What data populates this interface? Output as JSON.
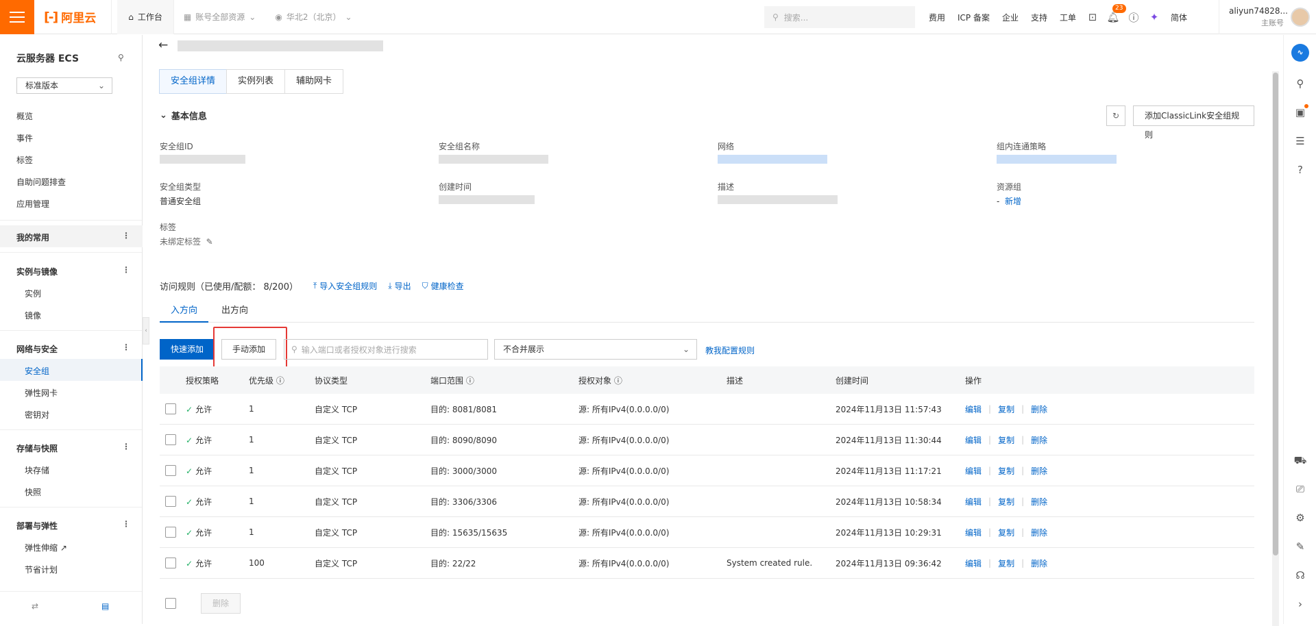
{
  "topbar": {
    "brand": "阿里云",
    "workbench": "工作台",
    "account_scope": "账号全部资源",
    "region": "华北2（北京）",
    "search_placeholder": "搜索...",
    "links": [
      "费用",
      "ICP 备案",
      "企业",
      "支持",
      "工单"
    ],
    "notification_count": "23",
    "language": "简体",
    "username": "aliyun74828...",
    "role": "主账号"
  },
  "sidebar": {
    "title": "云服务器 ECS",
    "version": "标准版本",
    "top_items": [
      "概览",
      "事件",
      "标签",
      "自助问题排查",
      "应用管理"
    ],
    "common": "我的常用",
    "groups": [
      {
        "title": "实例与镜像",
        "items": [
          "实例",
          "镜像"
        ]
      },
      {
        "title": "网络与安全",
        "items": [
          "安全组",
          "弹性网卡",
          "密钥对"
        ]
      },
      {
        "title": "存储与快照",
        "items": [
          "块存储",
          "快照"
        ]
      },
      {
        "title": "部署与弹性",
        "items": [
          "弹性伸缩",
          "节省计划"
        ]
      }
    ]
  },
  "tabs": [
    "安全组详情",
    "实例列表",
    "辅助网卡"
  ],
  "basic_info": {
    "title": "基本信息",
    "classic_button": "添加ClassicLink安全组规则",
    "labels": {
      "sg_id": "安全组ID",
      "sg_name": "安全组名称",
      "network": "网络",
      "intra_policy": "组内连通策略",
      "sg_type": "安全组类型",
      "created": "创建时间",
      "desc": "描述",
      "resource_group": "资源组",
      "tags": "标签"
    },
    "sg_type_value": "普通安全组",
    "resource_group_value": "-",
    "resource_group_add": "新增",
    "tags_value": "未绑定标签"
  },
  "rules": {
    "title": "访问规则（已使用/配额： 8/200）",
    "import": "导入安全组规则",
    "export": "导出",
    "health": "健康检查",
    "direction_in": "入方向",
    "direction_out": "出方向",
    "quick_add": "快速添加",
    "manual_add": "手动添加",
    "search_placeholder": "输入端口或者授权对象进行搜索",
    "merge_select": "不合并展示",
    "teach": "教我配置规则",
    "columns": [
      "授权策略",
      "优先级",
      "协议类型",
      "端口范围",
      "授权对象",
      "描述",
      "创建时间",
      "操作"
    ],
    "rows": [
      {
        "policy": "允许",
        "priority": "1",
        "protocol": "自定义 TCP",
        "port": "目的: 8081/8081",
        "target": "源: 所有IPv4(0.0.0.0/0)",
        "desc": "",
        "created": "2024年11月13日 11:57:43"
      },
      {
        "policy": "允许",
        "priority": "1",
        "protocol": "自定义 TCP",
        "port": "目的: 8090/8090",
        "target": "源: 所有IPv4(0.0.0.0/0)",
        "desc": "",
        "created": "2024年11月13日 11:30:44"
      },
      {
        "policy": "允许",
        "priority": "1",
        "protocol": "自定义 TCP",
        "port": "目的: 3000/3000",
        "target": "源: 所有IPv4(0.0.0.0/0)",
        "desc": "",
        "created": "2024年11月13日 11:17:21"
      },
      {
        "policy": "允许",
        "priority": "1",
        "protocol": "自定义 TCP",
        "port": "目的: 3306/3306",
        "target": "源: 所有IPv4(0.0.0.0/0)",
        "desc": "",
        "created": "2024年11月13日 10:58:34"
      },
      {
        "policy": "允许",
        "priority": "1",
        "protocol": "自定义 TCP",
        "port": "目的: 15635/15635",
        "target": "源: 所有IPv4(0.0.0.0/0)",
        "desc": "",
        "created": "2024年11月13日 10:29:31"
      },
      {
        "policy": "允许",
        "priority": "100",
        "protocol": "自定义 TCP",
        "port": "目的: 22/22",
        "target": "源: 所有IPv4(0.0.0.0/0)",
        "desc": "System created rule.",
        "created": "2024年11月13日 09:36:42"
      }
    ],
    "ops": [
      "编辑",
      "复制",
      "删除"
    ],
    "delete_button": "删除"
  },
  "colors": {
    "accent": "#0064c8",
    "brand": "#ff6a00",
    "highlight": "#e53935"
  }
}
